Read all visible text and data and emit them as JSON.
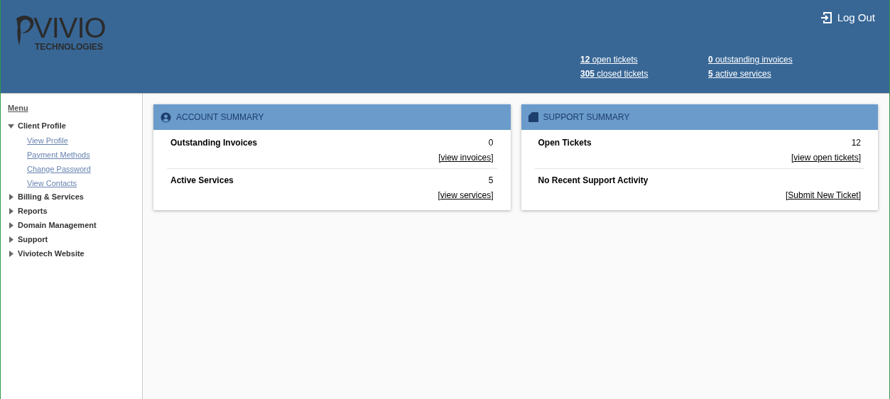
{
  "header": {
    "logo": {
      "name": "VIVIO",
      "subtitle": "TECHNOLOGIES"
    },
    "logout": "Log Out",
    "stats": [
      {
        "text": "**12** open tickets"
      },
      {
        "text": "**0** outstanding invoices"
      },
      {
        "text": "**305** closed tickets"
      },
      {
        "text": "**5** active services"
      }
    ]
  },
  "sidebar": {
    "title": "Menu",
    "items": [
      {
        "label": "Client Profile",
        "expanded": true,
        "children": [
          {
            "label": "View Profile"
          },
          {
            "label": "Payment Methods"
          },
          {
            "label": "Change Password"
          },
          {
            "label": "View Contacts"
          }
        ]
      },
      {
        "label": "Billing & Services",
        "expanded": false
      },
      {
        "label": "Reports",
        "expanded": false
      },
      {
        "label": "Domain Management",
        "expanded": false
      },
      {
        "label": "Support",
        "expanded": false
      },
      {
        "label": "Viviotech Website",
        "expanded": false
      }
    ]
  },
  "panels": [
    {
      "kind": "account",
      "title": "ACCOUNT SUMMARY",
      "rows": [
        {
          "label": "Outstanding Invoices",
          "value": "0",
          "link": "[view invoices]"
        },
        {
          "label": "Active Services",
          "value": "5",
          "link": "[view services]"
        }
      ]
    },
    {
      "kind": "support",
      "title": "SUPPORT SUMMARY",
      "rows": [
        {
          "label": "Open Tickets",
          "value": "12",
          "link": "[view open tickets]"
        },
        {
          "label": "No Recent Support Activity",
          "link": "[Submit New Ticket]"
        }
      ]
    }
  ]
}
